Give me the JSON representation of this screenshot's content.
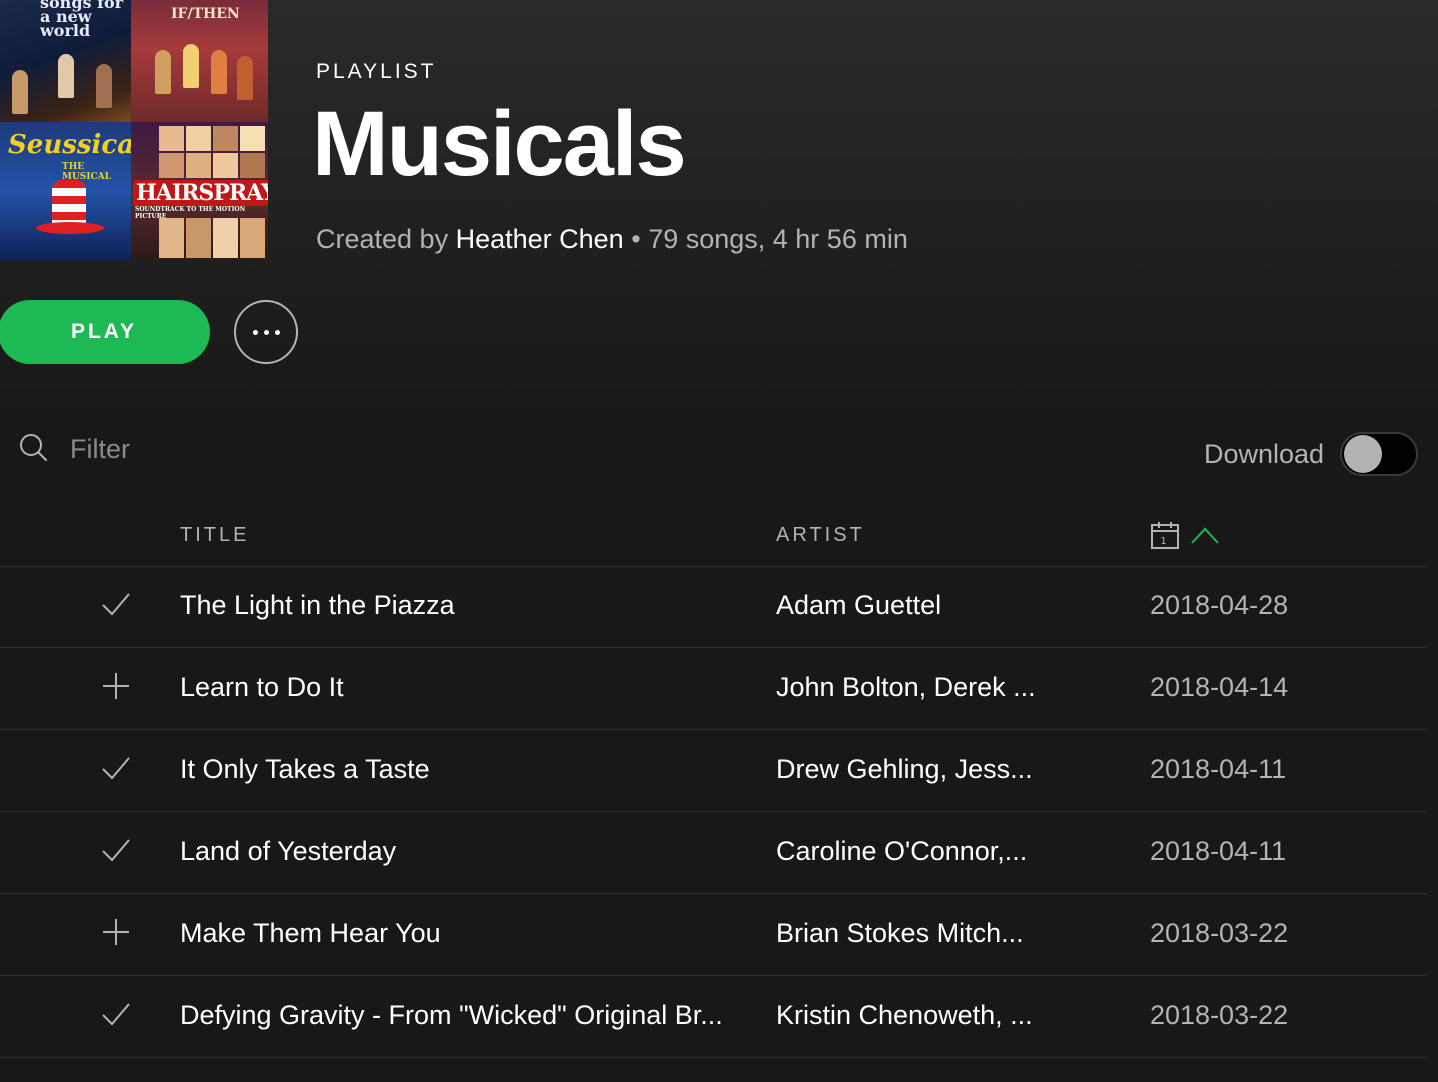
{
  "cover": {
    "tiles": [
      {
        "text": "songs for a new world"
      },
      {
        "text": "IF/THEN"
      },
      {
        "text": "Seussical",
        "sub": "THE MUSICAL"
      },
      {
        "text": "HAIRSPRAY",
        "sub": "SOUNDTRACK TO THE MOTION PICTURE"
      }
    ]
  },
  "header": {
    "type_label": "PLAYLIST",
    "title": "Musicals",
    "created_by_prefix": "Created by",
    "owner": "Heather Chen",
    "separator": "•",
    "stats": "79 songs, 4 hr 56 min"
  },
  "actions": {
    "play_label": "PLAY",
    "more_icon": "ellipsis-icon"
  },
  "filter": {
    "placeholder": "Filter",
    "value": "",
    "icon": "search-icon"
  },
  "download": {
    "label": "Download",
    "enabled": false
  },
  "table": {
    "columns": {
      "title": "TITLE",
      "artist": "ARTIST",
      "date_icon": "calendar-icon",
      "sort_icon": "chevron-up-icon"
    },
    "accent_color": "#1db954",
    "rows": [
      {
        "state": "check",
        "title": "The Light in the Piazza",
        "artist": "Adam Guettel",
        "date": "2018-04-28"
      },
      {
        "state": "plus",
        "title": "Learn to Do It",
        "artist": "John Bolton, Derek ...",
        "date": "2018-04-14"
      },
      {
        "state": "check",
        "title": "It Only Takes a Taste",
        "artist": "Drew Gehling, Jess...",
        "date": "2018-04-11"
      },
      {
        "state": "check",
        "title": "Land of Yesterday",
        "artist": "Caroline O'Connor,...",
        "date": "2018-04-11"
      },
      {
        "state": "plus",
        "title": "Make Them Hear You",
        "artist": "Brian Stokes Mitch...",
        "date": "2018-03-22"
      },
      {
        "state": "check",
        "title": "Defying Gravity - From \"Wicked\" Original Br...",
        "artist": "Kristin Chenoweth, ...",
        "date": "2018-03-22"
      }
    ]
  }
}
